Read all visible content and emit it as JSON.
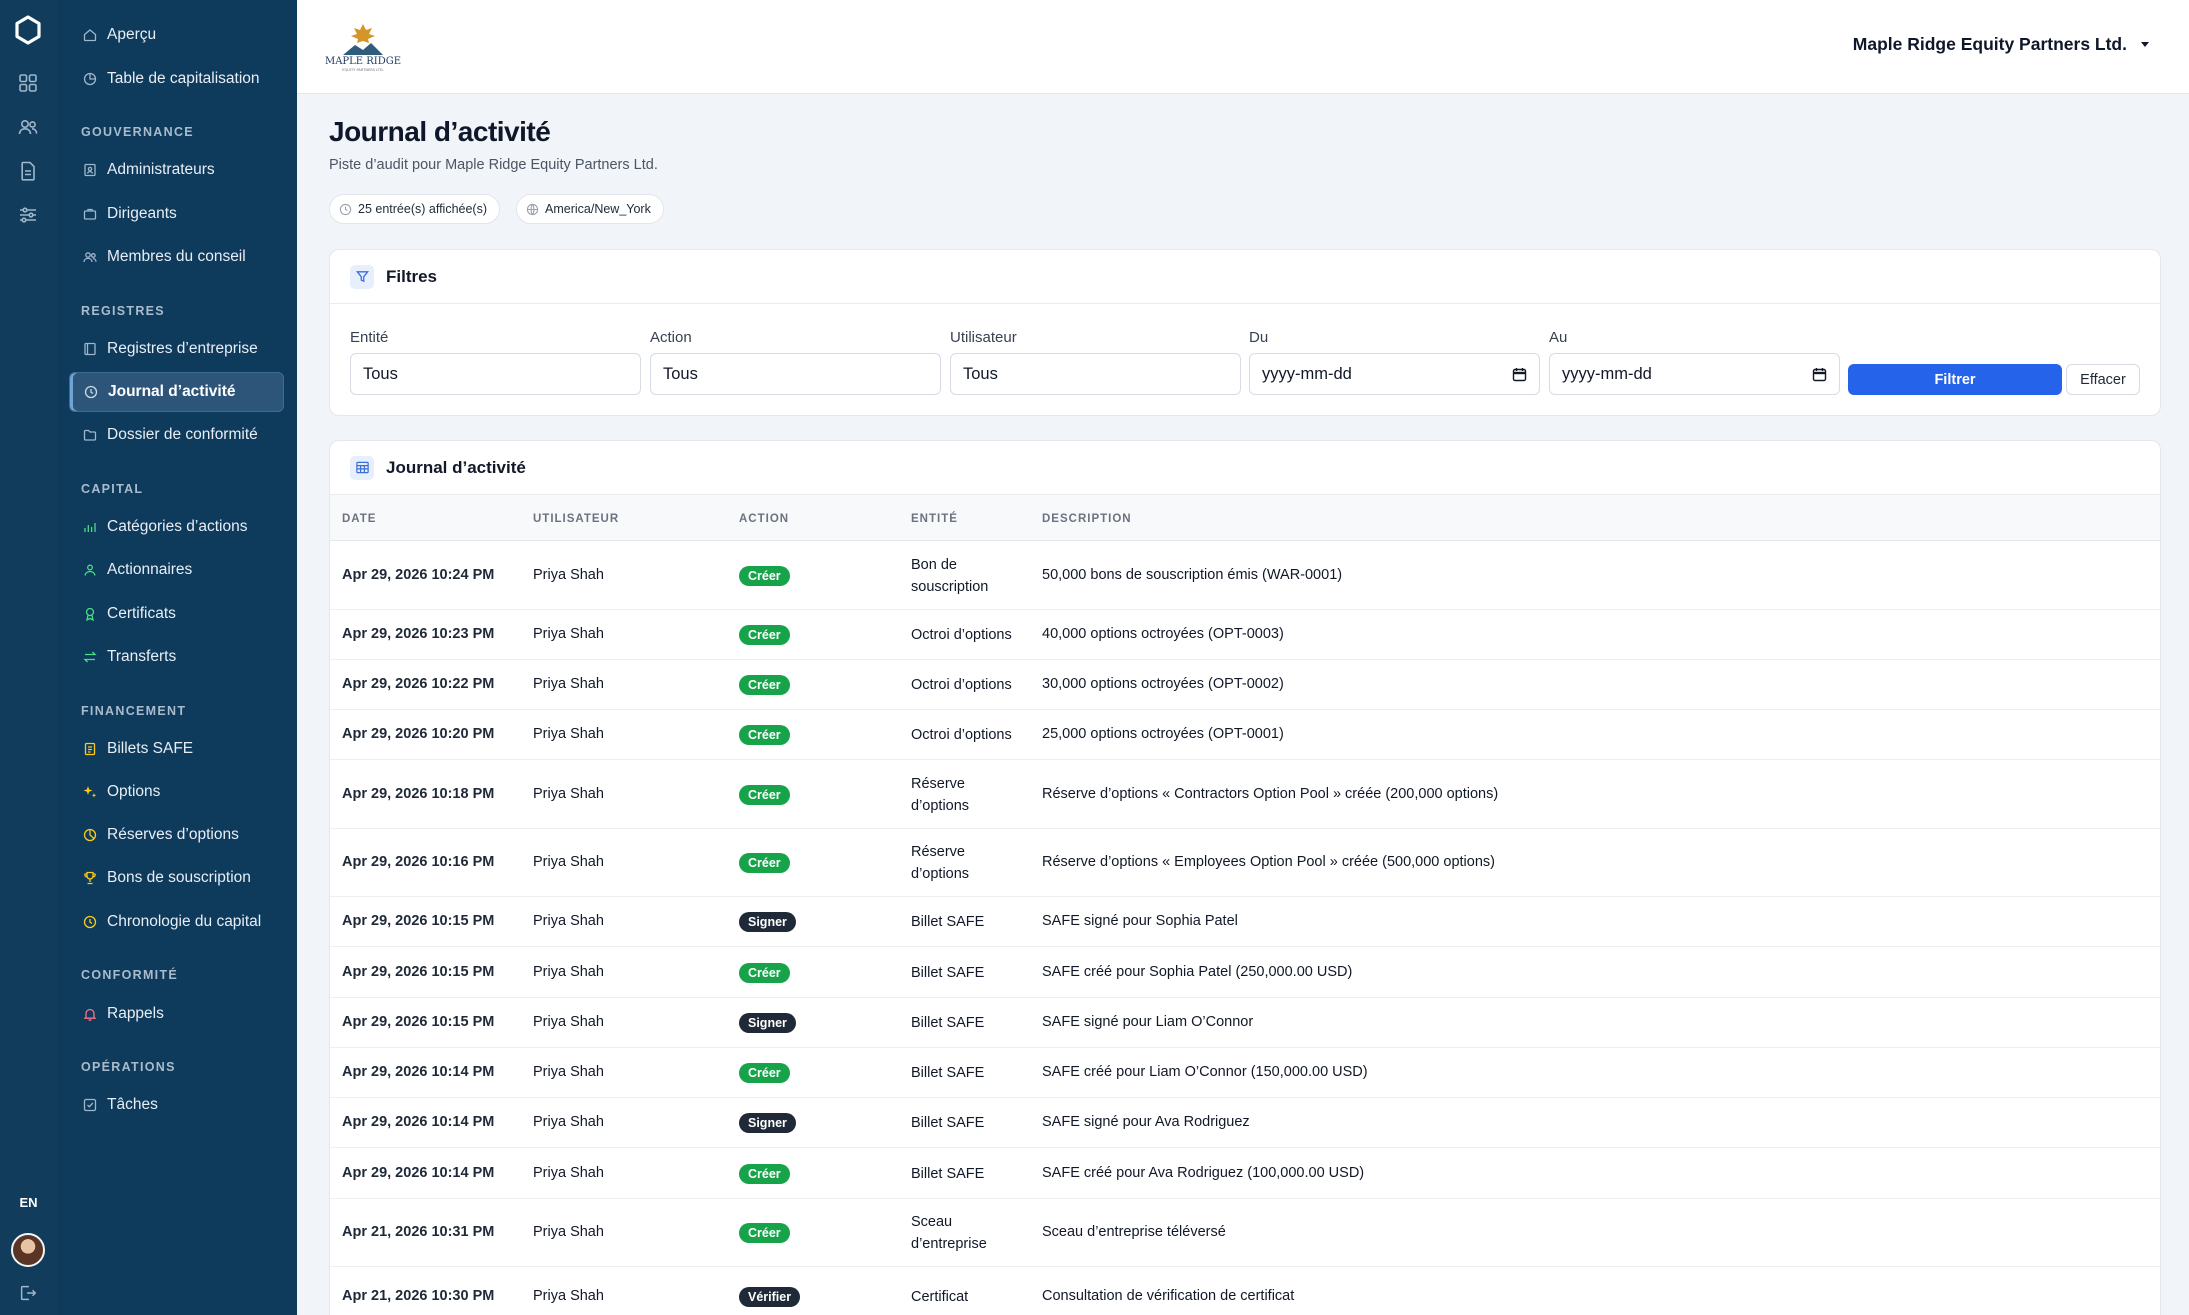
{
  "rail": {
    "lang": "EN"
  },
  "sidebar": {
    "top_items": [
      {
        "label": "Aperçu",
        "icon": "home-icon"
      },
      {
        "label": "Table de capitalisation",
        "icon": "pie-chart-icon"
      }
    ],
    "sections": [
      {
        "title": "GOUVERNANCE",
        "items": [
          {
            "label": "Administrateurs",
            "icon": "id-badge-icon"
          },
          {
            "label": "Dirigeants",
            "icon": "briefcase-icon"
          },
          {
            "label": "Membres du conseil",
            "icon": "users-icon"
          }
        ]
      },
      {
        "title": "REGISTRES",
        "items": [
          {
            "label": "Registres d’entreprise",
            "icon": "book-icon"
          },
          {
            "label": "Journal d’activité",
            "icon": "clock-icon",
            "active": true
          },
          {
            "label": "Dossier de conformité",
            "icon": "folder-icon"
          }
        ]
      },
      {
        "title": "CAPITAL",
        "items": [
          {
            "label": "Catégories d’actions",
            "icon": "layers-icon"
          },
          {
            "label": "Actionnaires",
            "icon": "user-group-icon"
          },
          {
            "label": "Certificats",
            "icon": "award-icon"
          },
          {
            "label": "Transferts",
            "icon": "arrows-icon"
          }
        ]
      },
      {
        "title": "FINANCEMENT",
        "items": [
          {
            "label": "Billets SAFE",
            "icon": "document-icon"
          },
          {
            "label": "Options",
            "icon": "sparkle-icon"
          },
          {
            "label": "Réserves d’options",
            "icon": "pie-icon"
          },
          {
            "label": "Bons de souscription",
            "icon": "trophy-icon"
          },
          {
            "label": "Chronologie du capital",
            "icon": "history-icon"
          }
        ]
      },
      {
        "title": "CONFORMITÉ",
        "items": [
          {
            "label": "Rappels",
            "icon": "bell-icon"
          }
        ]
      },
      {
        "title": "OPÉRATIONS",
        "items": [
          {
            "label": "Tâches",
            "icon": "checklist-icon"
          }
        ]
      }
    ]
  },
  "header": {
    "logo_text": "MAPLE RIDGE",
    "logo_subtext": "EQUITY PARTNERS LTD.",
    "company_name": "Maple Ridge Equity Partners Ltd."
  },
  "page": {
    "title": "Journal d’activité",
    "subtitle": "Piste d’audit pour Maple Ridge Equity Partners Ltd.",
    "entries_chip": "25 entrée(s) affichée(s)",
    "timezone_chip": "America/New_York"
  },
  "filters": {
    "title": "Filtres",
    "entity_label": "Entité",
    "entity_value": "Tous",
    "action_label": "Action",
    "action_value": "Tous",
    "user_label": "Utilisateur",
    "user_value": "Tous",
    "from_label": "Du",
    "from_placeholder": "yyyy-mm-dd",
    "to_label": "Au",
    "to_placeholder": "yyyy-mm-dd",
    "filter_button": "Filtrer",
    "clear_button": "Effacer"
  },
  "table": {
    "title": "Journal d’activité",
    "columns": [
      "DATE",
      "UTILISATEUR",
      "ACTION",
      "ENTITÉ",
      "DESCRIPTION"
    ],
    "rows": [
      {
        "date": "Apr 29, 2026 10:24 PM",
        "user": "Priya Shah",
        "action": "Créer",
        "entity": "Bon de souscription",
        "description": "50,000 bons de souscription émis (WAR-0001)"
      },
      {
        "date": "Apr 29, 2026 10:23 PM",
        "user": "Priya Shah",
        "action": "Créer",
        "entity": "Octroi d’options",
        "description": "40,000 options octroyées (OPT-0003)"
      },
      {
        "date": "Apr 29, 2026 10:22 PM",
        "user": "Priya Shah",
        "action": "Créer",
        "entity": "Octroi d’options",
        "description": "30,000 options octroyées (OPT-0002)"
      },
      {
        "date": "Apr 29, 2026 10:20 PM",
        "user": "Priya Shah",
        "action": "Créer",
        "entity": "Octroi d’options",
        "description": "25,000 options octroyées (OPT-0001)"
      },
      {
        "date": "Apr 29, 2026 10:18 PM",
        "user": "Priya Shah",
        "action": "Créer",
        "entity": "Réserve d’options",
        "description": "Réserve d’options « Contractors Option Pool » créée (200,000 options)"
      },
      {
        "date": "Apr 29, 2026 10:16 PM",
        "user": "Priya Shah",
        "action": "Créer",
        "entity": "Réserve d’options",
        "description": "Réserve d’options « Employees Option Pool » créée (500,000 options)"
      },
      {
        "date": "Apr 29, 2026 10:15 PM",
        "user": "Priya Shah",
        "action": "Signer",
        "entity": "Billet SAFE",
        "description": "SAFE signé pour Sophia Patel"
      },
      {
        "date": "Apr 29, 2026 10:15 PM",
        "user": "Priya Shah",
        "action": "Créer",
        "entity": "Billet SAFE",
        "description": "SAFE créé pour Sophia Patel (250,000.00 USD)"
      },
      {
        "date": "Apr 29, 2026 10:15 PM",
        "user": "Priya Shah",
        "action": "Signer",
        "entity": "Billet SAFE",
        "description": "SAFE signé pour Liam O’Connor"
      },
      {
        "date": "Apr 29, 2026 10:14 PM",
        "user": "Priya Shah",
        "action": "Créer",
        "entity": "Billet SAFE",
        "description": "SAFE créé pour Liam O’Connor (150,000.00 USD)"
      },
      {
        "date": "Apr 29, 2026 10:14 PM",
        "user": "Priya Shah",
        "action": "Signer",
        "entity": "Billet SAFE",
        "description": "SAFE signé pour Ava Rodriguez"
      },
      {
        "date": "Apr 29, 2026 10:14 PM",
        "user": "Priya Shah",
        "action": "Créer",
        "entity": "Billet SAFE",
        "description": "SAFE créé pour Ava Rodriguez (100,000.00 USD)"
      },
      {
        "date": "Apr 21, 2026 10:31 PM",
        "user": "Priya Shah",
        "action": "Créer",
        "entity": "Sceau d’entreprise",
        "description": "Sceau d’entreprise téléversé"
      },
      {
        "date": "Apr 21, 2026 10:30 PM",
        "user": "Priya Shah",
        "action": "Vérifier",
        "entity": "Certificat",
        "description": "Consultation de vérification de certificat"
      }
    ]
  },
  "colors": {
    "rail_bg": "#113c5c",
    "sidebar_bg": "#0e3a5c",
    "accent": "#2563eb",
    "badge_create": "#16a34a",
    "badge_sign": "#1f2937"
  }
}
